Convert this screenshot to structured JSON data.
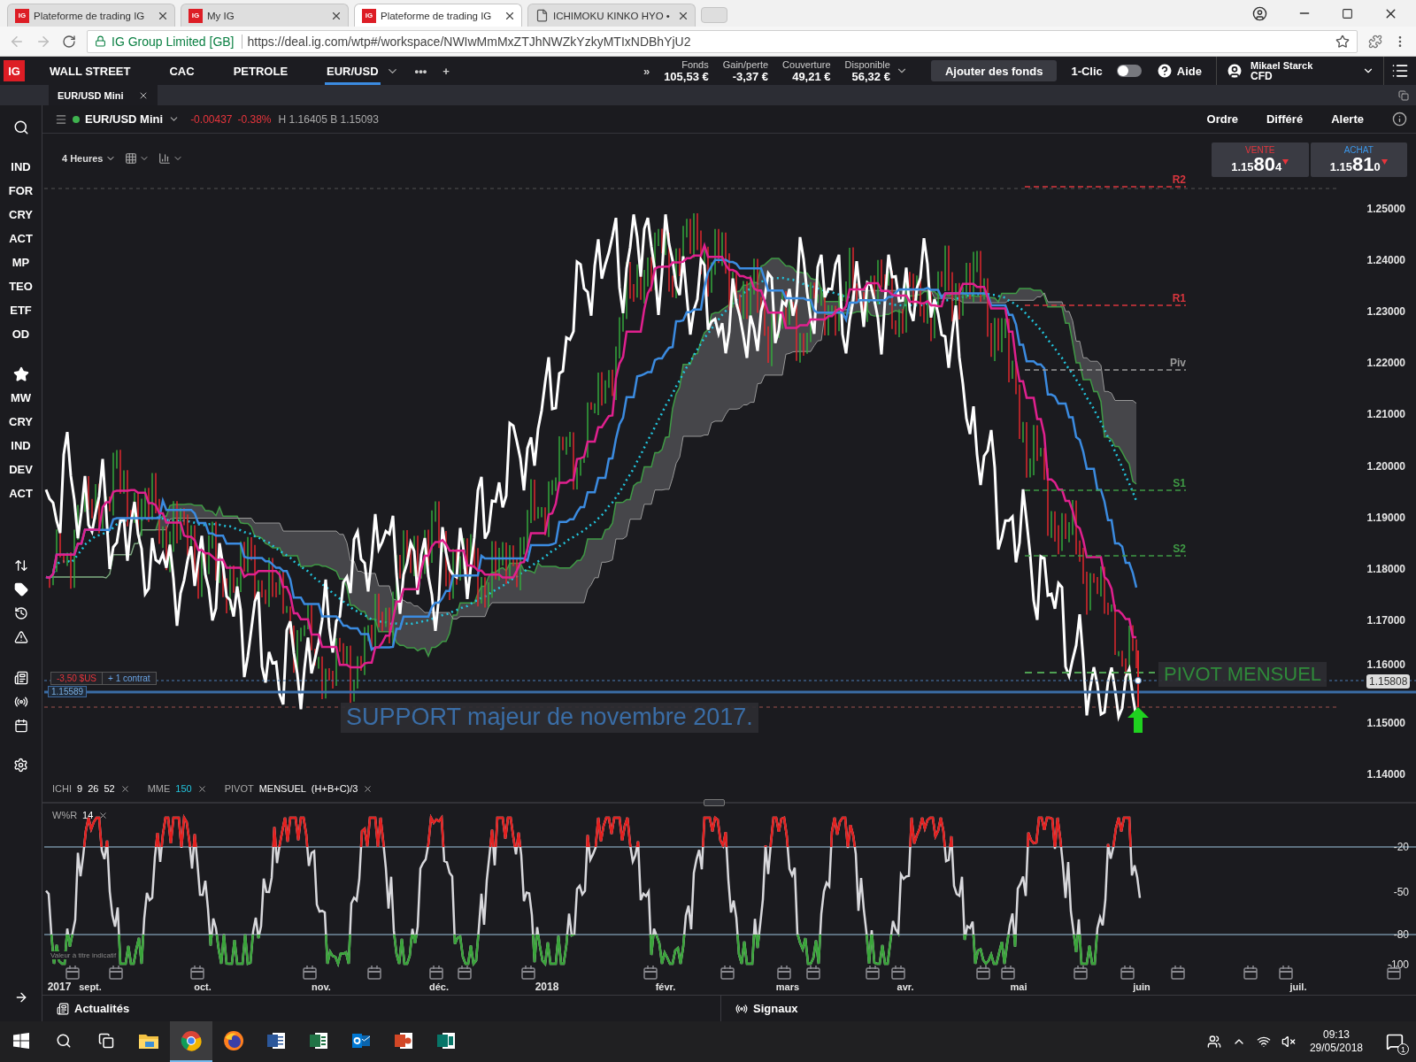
{
  "browser": {
    "tabs": [
      {
        "favicon": "IG",
        "title": "Plateforme de trading IG",
        "selected": false
      },
      {
        "favicon": "IG",
        "title": "My IG",
        "selected": false
      },
      {
        "favicon": "IG",
        "title": "Plateforme de trading IG",
        "selected": true
      },
      {
        "title": "ICHIMOKU KINKO HYO •",
        "selected": false
      }
    ],
    "site": "IG Group Limited [GB]",
    "url": "https://deal.ig.com/wtp#/workspace/NWIwMmMxZTJhNWZkYzkyMTIxNDBhYjU2"
  },
  "app": {
    "logo": "IG",
    "markets": [
      {
        "label": "WALL STREET",
        "selected": false
      },
      {
        "label": "CAC",
        "selected": false
      },
      {
        "label": "PETROLE",
        "selected": false
      },
      {
        "label": "EUR/USD",
        "selected": true
      }
    ],
    "more": "•••",
    "add": "+",
    "collapse": "»",
    "account": [
      {
        "label": "Fonds",
        "value": "105,53 €"
      },
      {
        "label": "Gain/perte",
        "value": "-3,37 €"
      },
      {
        "label": "Couverture",
        "value": "49,21 €"
      },
      {
        "label": "Disponible",
        "value": "56,32 €"
      }
    ],
    "add_funds": "Ajouter des fonds",
    "one_click": {
      "label": "1-Clic",
      "on": false
    },
    "help": "Aide",
    "user": {
      "name": "Mikael Starck",
      "account": "CFD"
    }
  },
  "workspace_tabs": [
    {
      "label": "EUR/USD Mini",
      "selected": true
    }
  ],
  "sidebar": {
    "markets": [
      "IND",
      "FOR",
      "CRY",
      "ACT",
      "MP",
      "TEO",
      "ETF",
      "OD"
    ],
    "watchlists": [
      "MW",
      "CRY",
      "IND",
      "DEV",
      "ACT"
    ]
  },
  "instrument": {
    "name": "EUR/USD Mini",
    "change": "-0.00437",
    "change_pct": "-0.38%",
    "range": "H 1.16405 B 1.15093"
  },
  "actions": [
    "Ordre",
    "Différé",
    "Alerte"
  ],
  "chart": {
    "timeframe": "4 Heures",
    "deal": [
      {
        "kind": "sell",
        "side": "VENTE",
        "big_figure": "1.15",
        "pips": "80",
        "fraction": "4"
      },
      {
        "kind": "buy",
        "side": "ACHAT",
        "big_figure": "1.15",
        "pips": "81",
        "fraction": "0"
      }
    ],
    "price_axis": [
      "1.25000",
      "1.24000",
      "1.23000",
      "1.22000",
      "1.21000",
      "1.20000",
      "1.19000",
      "1.18000",
      "1.17000",
      "1.16000",
      "1.15000",
      "1.14000"
    ],
    "pivots": [
      {
        "label": "R2",
        "color": "#d9363e"
      },
      {
        "label": "R1",
        "color": "#d9363e"
      },
      {
        "label": "Piv",
        "color": "#9a9a9a"
      },
      {
        "label": "S1",
        "color": "#3f9a45"
      },
      {
        "label": "S2",
        "color": "#3f9a45"
      }
    ],
    "position": {
      "pnl": "-3,50 $US",
      "size": "+ 1 contrat",
      "open_level": "1.15589"
    },
    "current_price": "1.15808",
    "annotations": [
      {
        "text": "PIVOT MENSUEL",
        "color": "#2f8a3a"
      },
      {
        "text": "SUPPORT majeur de novembre 2017.",
        "color": "#3a6da6"
      }
    ],
    "indicators": [
      {
        "name": "ICHI",
        "params": [
          "9",
          "26",
          "52"
        ]
      },
      {
        "name": "MME",
        "params": [
          "150"
        ]
      },
      {
        "name": "PIVOT",
        "params": [
          "MENSUEL",
          "(H+B+C)/3"
        ]
      }
    ],
    "oscillator": {
      "name": "W%R",
      "param": "14",
      "axis": [
        "-20",
        "-50",
        "-80",
        "-100"
      ],
      "note": "Valeur à titre indicatif"
    },
    "time_axis": [
      "2017",
      "sept.",
      "oct.",
      "nov.",
      "déc.",
      "2018",
      "févr.",
      "mars",
      "avr.",
      "mai",
      "juin",
      "juil."
    ]
  },
  "bottom_tabs": [
    "Actualités",
    "Signaux"
  ],
  "taskbar": {
    "apps": [
      {
        "kind": "folder",
        "selected": false
      },
      {
        "kind": "chrome",
        "selected": true
      },
      {
        "kind": "firefox",
        "selected": false
      },
      {
        "kind": "word",
        "selected": false
      },
      {
        "kind": "excel",
        "selected": false
      },
      {
        "kind": "outlook",
        "selected": false
      },
      {
        "kind": "powerpoint",
        "selected": false
      },
      {
        "kind": "publisher",
        "selected": false
      }
    ],
    "time": "09:13",
    "date": "29/05/2018",
    "notifications": "1"
  }
}
